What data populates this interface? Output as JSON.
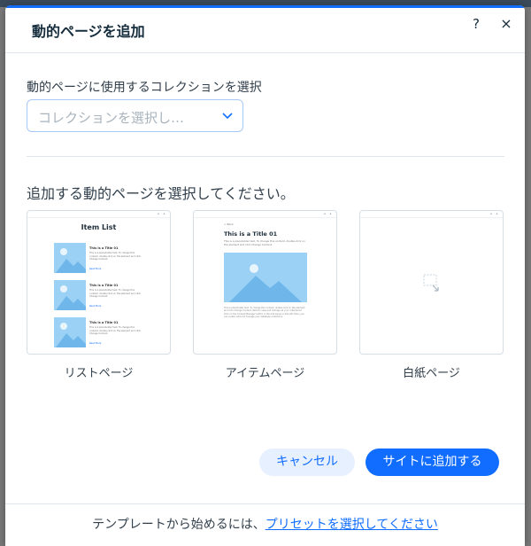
{
  "dialog": {
    "title": "動的ページを追加",
    "help": "?",
    "close": "×"
  },
  "collection": {
    "label": "動的ページに使用するコレクションを選択",
    "placeholder": "コレクションを選択し…"
  },
  "page_type": {
    "label": "追加する動的ページを選択してください。",
    "cards": [
      {
        "label": "リストページ",
        "preview_title": "Item List",
        "item_title": "This is a Title 01",
        "item_text": "This is a placeholder text. To change this content, double-click on the element and click Change Content.",
        "link_text": "Read More"
      },
      {
        "label": "アイテムページ",
        "back_text": "< Back",
        "preview_title": "This is a Title 01",
        "intro_text": "This is a placeholder text. To change this content, double-click on the element and click Change Content.",
        "body_text": "This is placeholder text. To change this content, double-click on the element and click Change Content. Want to view and manage all your collections? Click on the Content Manager button in the Add panel on the left. Here, you can create, edit and manage your database collections."
      },
      {
        "label": "白紙ページ"
      }
    ],
    "window_dots": "• •"
  },
  "actions": {
    "cancel": "キャンセル",
    "add": "サイトに追加する"
  },
  "footer": {
    "text": "テンプレートから始めるには、",
    "link": "プリセットを選択してください"
  },
  "colors": {
    "accent": "#116dff",
    "accent_light": "#e7f0ff",
    "image_placeholder": "#9bd1f5"
  }
}
